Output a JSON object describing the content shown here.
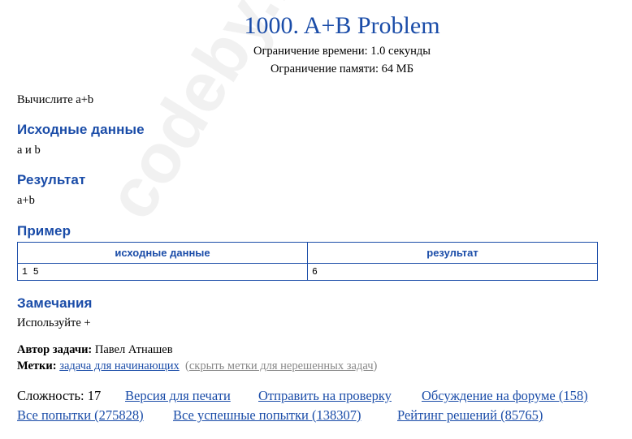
{
  "watermark": "codeby.net",
  "problem": {
    "title": "1000. A+B Problem",
    "time_limit": "Ограничение времени: 1.0 секунды",
    "memory_limit": "Ограничение памяти: 64 МБ",
    "statement": "Вычислите a+b"
  },
  "input_section": {
    "heading": "Исходные данные",
    "text": "a и b"
  },
  "output_section": {
    "heading": "Результат",
    "text": "a+b"
  },
  "sample": {
    "heading": "Пример",
    "columns": [
      "исходные данные",
      "результат"
    ],
    "rows": [
      [
        "1 5",
        "6"
      ]
    ]
  },
  "notes": {
    "heading": "Замечания",
    "text": "Используйте +"
  },
  "author": {
    "label": "Автор задачи:",
    "name": "Павел Атнашев"
  },
  "tags": {
    "label": "Метки:",
    "tag": "задача для начинающих",
    "toggle": "скрыть метки для нерешенных задач",
    "open_paren": "(",
    "close_paren": ")"
  },
  "footer": {
    "difficulty": "Сложность: 17",
    "print_version": "Версия для печати",
    "submit": "Отправить на проверку",
    "forum": "Обсуждение на форуме (158)",
    "all_attempts": "Все попытки (275828)",
    "successful_attempts": "Все успешные попытки (138307)",
    "rating": "Рейтинг решений (85765)"
  }
}
